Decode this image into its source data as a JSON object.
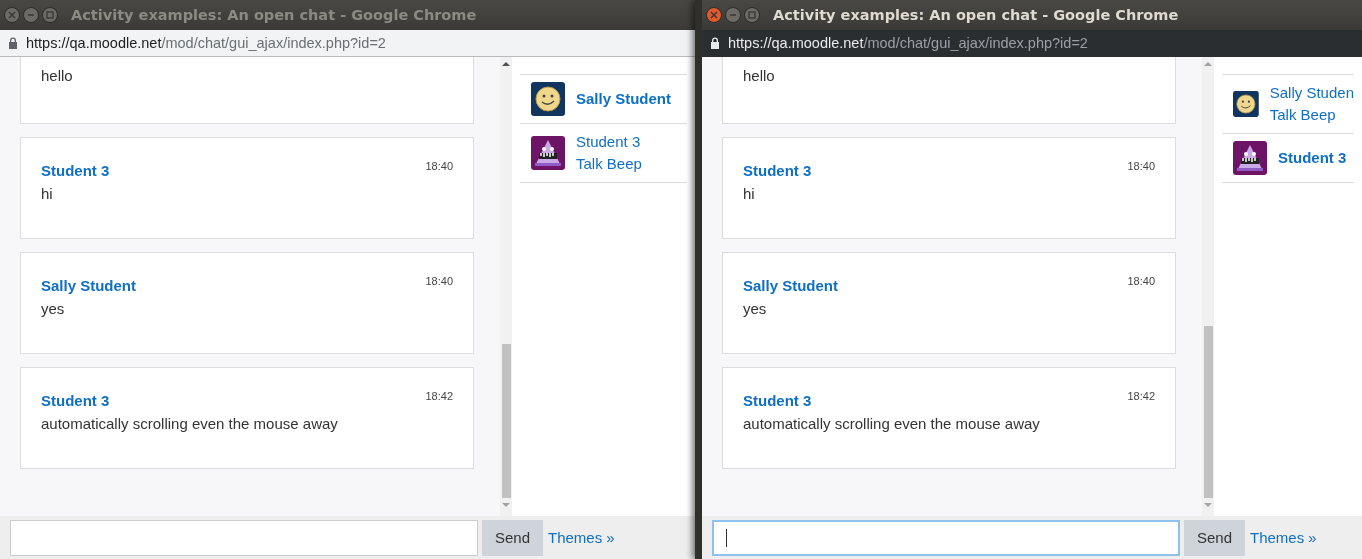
{
  "windows": [
    {
      "title": "Activity examples: An open chat - Google Chrome",
      "active": false,
      "url": {
        "host": "https://qa.moodle.net",
        "path": "/mod/chat/gui_ajax/index.php?id=2"
      },
      "messages": [
        {
          "text": "hello"
        },
        {
          "sender": "Student 3",
          "time": "18:40",
          "text": "hi"
        },
        {
          "sender": "Sally Student",
          "time": "18:40",
          "text": "yes"
        },
        {
          "sender": "Student 3",
          "time": "18:42",
          "text": "automatically scrolling even the mouse away"
        }
      ],
      "users": [
        {
          "name": "Sally Student",
          "kind": "smiley",
          "current": true
        },
        {
          "name": "Student 3",
          "kind": "monster",
          "current": false,
          "action": "Talk Beep"
        }
      ],
      "input": {
        "focused": false
      },
      "send_button": "Send",
      "themes_link": "Themes »"
    },
    {
      "title": "Activity examples: An open chat - Google Chrome",
      "active": true,
      "url": {
        "host": "https://qa.moodle.net",
        "path": "/mod/chat/gui_ajax/index.php?id=2"
      },
      "messages": [
        {
          "text": "hello"
        },
        {
          "sender": "Student 3",
          "time": "18:40",
          "text": "hi"
        },
        {
          "sender": "Sally Student",
          "time": "18:40",
          "text": "yes"
        },
        {
          "sender": "Student 3",
          "time": "18:42",
          "text": "automatically scrolling even the mouse away"
        }
      ],
      "users": [
        {
          "name": "Sally Studen",
          "kind": "smiley",
          "current": false,
          "action": "Talk Beep"
        },
        {
          "name": "Student 3",
          "kind": "monster",
          "current": true
        }
      ],
      "input": {
        "focused": true
      },
      "send_button": "Send",
      "themes_link": "Themes »"
    }
  ]
}
